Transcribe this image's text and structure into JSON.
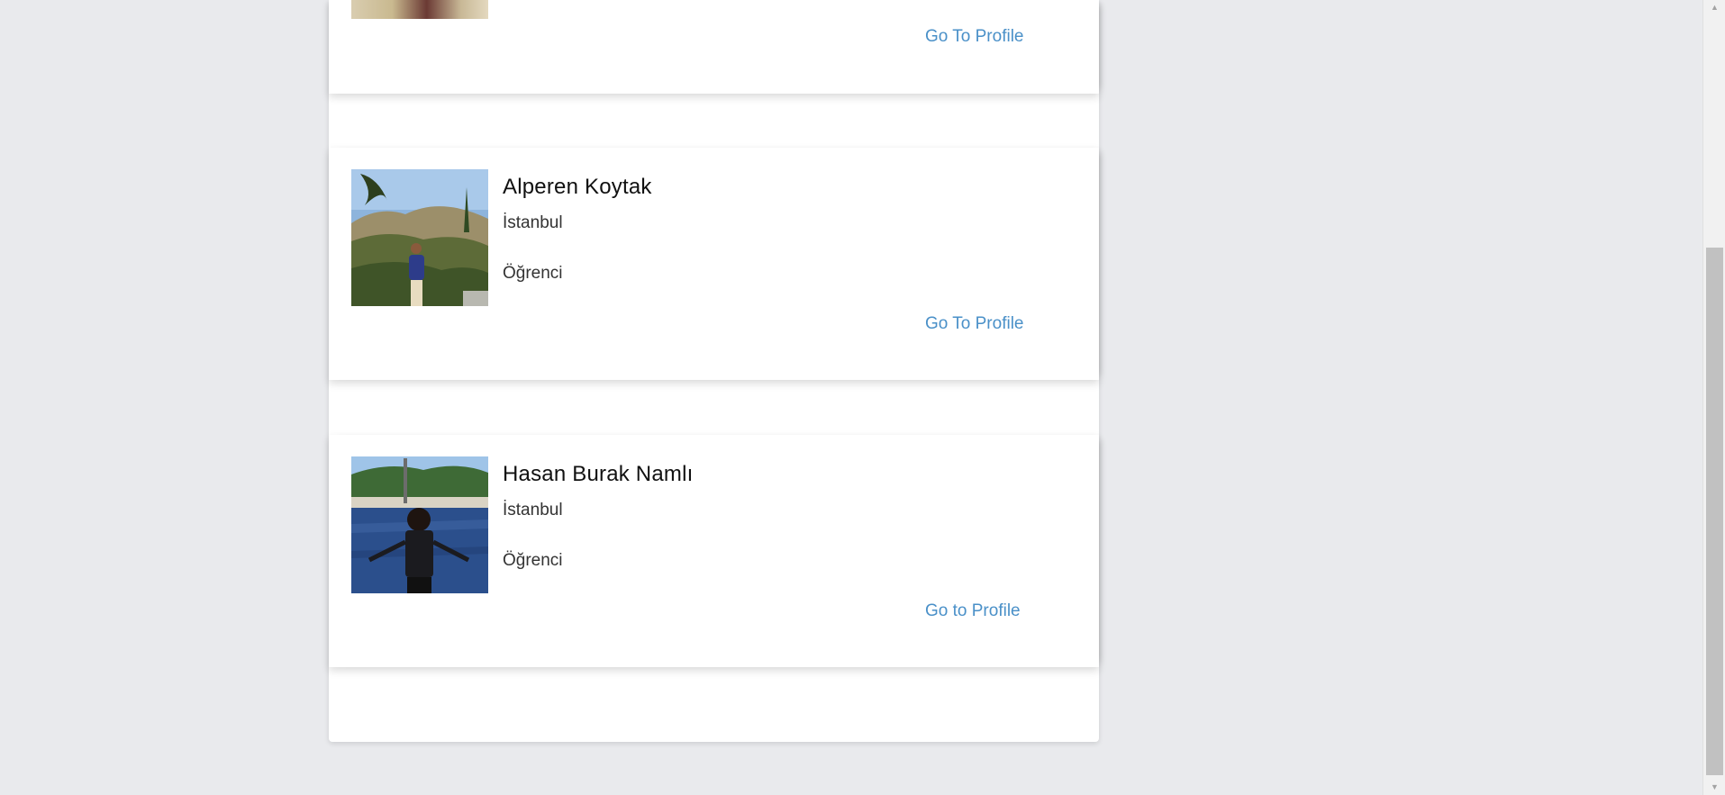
{
  "cards": [
    {
      "go_to_profile_label": "Go To Profile"
    },
    {
      "name": "Alperen Koytak",
      "city": "İstanbul",
      "role": "Öğrenci",
      "go_to_profile_label": "Go To Profile"
    },
    {
      "name": "Hasan Burak Namlı",
      "city": "İstanbul",
      "role": "Öğrenci",
      "go_to_profile_label": "Go to Profile"
    }
  ],
  "scrollbar": {
    "up_icon": "▲",
    "down_icon": "▼"
  },
  "colors": {
    "page_background": "#e9eaed",
    "link": "#4a90c8",
    "card_background": "#ffffff"
  }
}
